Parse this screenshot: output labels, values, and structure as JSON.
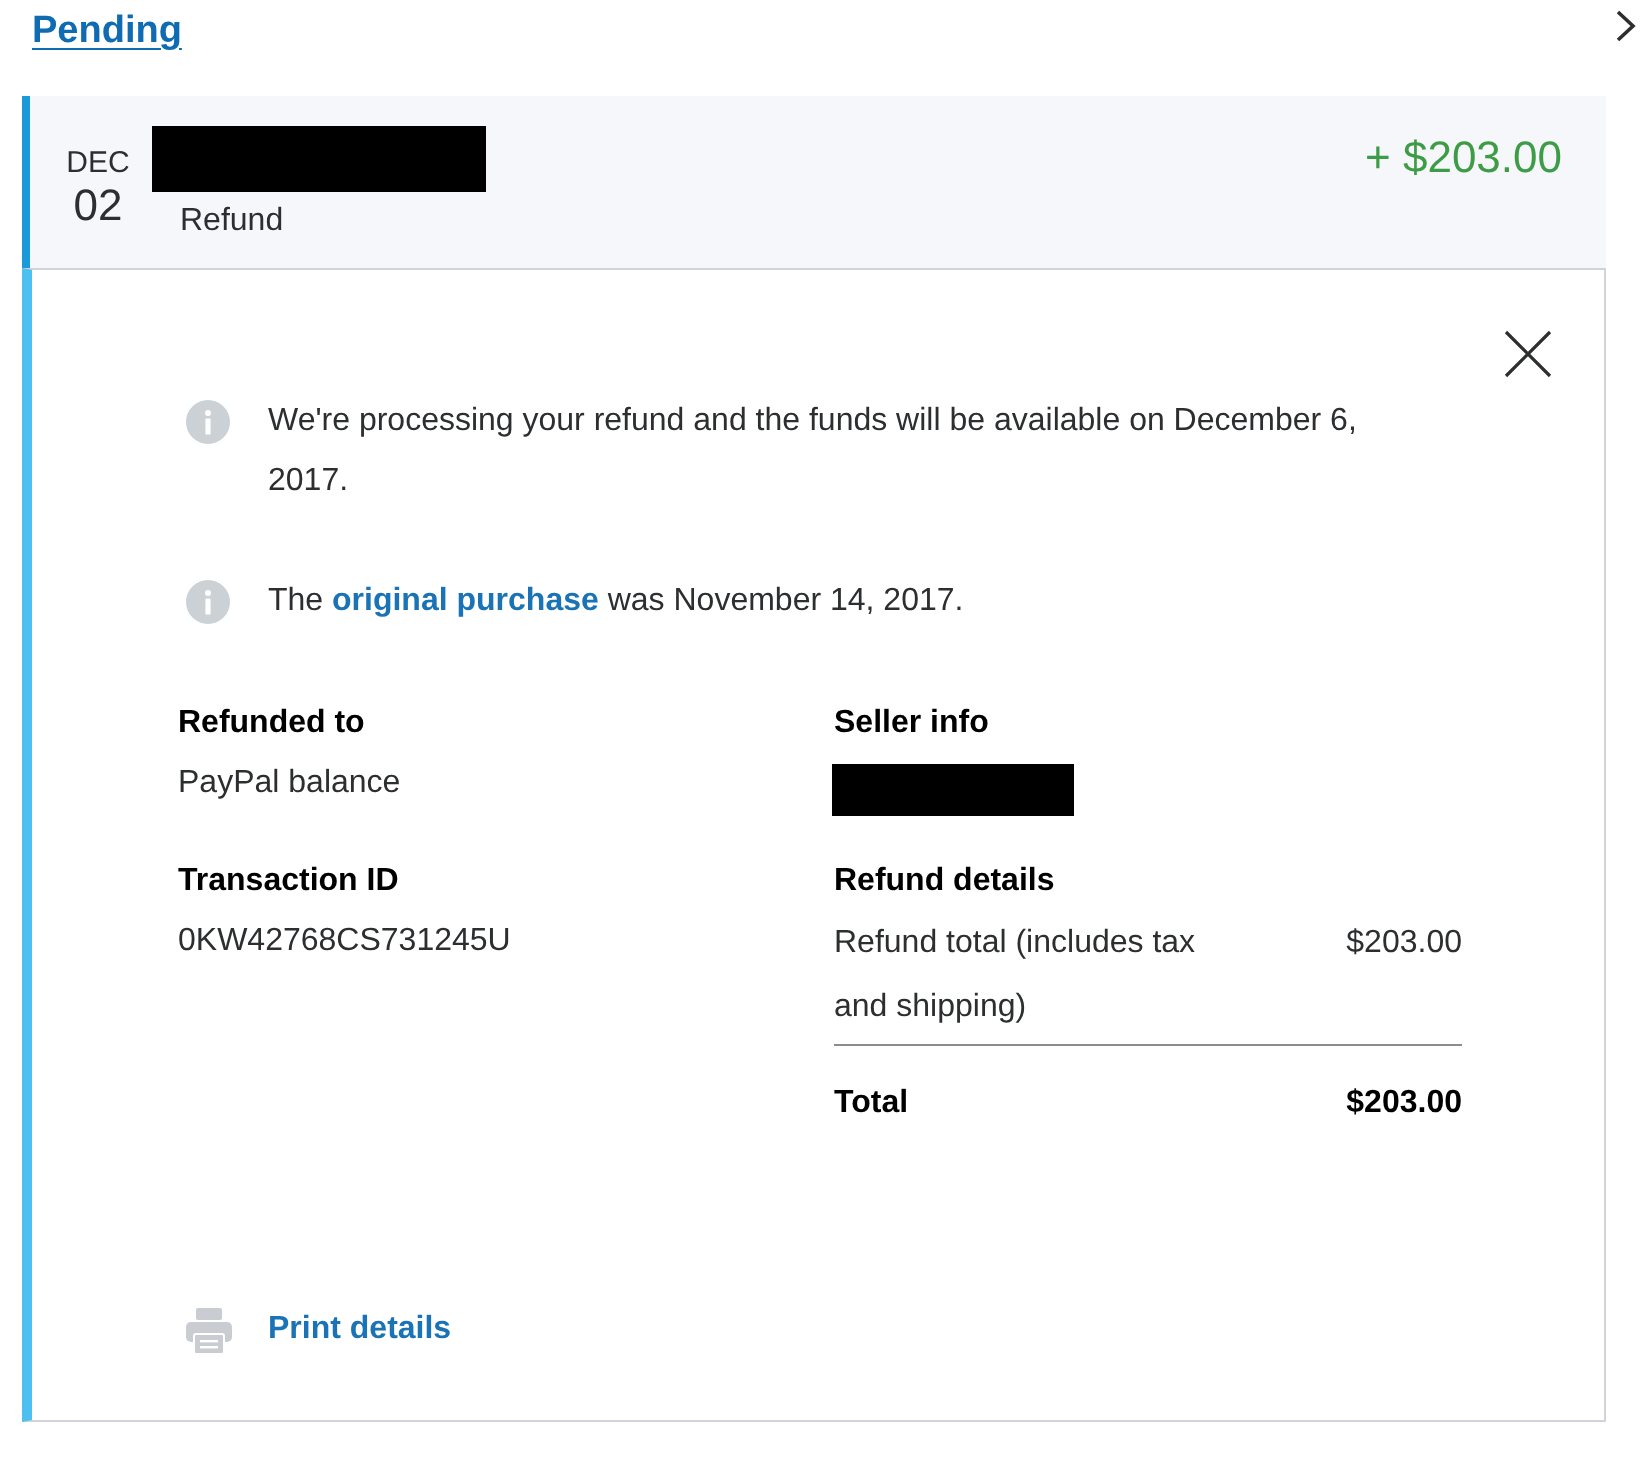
{
  "pending_link": "Pending",
  "transaction": {
    "month": "DEC",
    "day": "02",
    "name_redacted": true,
    "type": "Refund",
    "amount": "+ $203.00"
  },
  "notices": [
    {
      "parts": [
        {
          "text": "We're processing your refund and the funds will be available on December 6, 2017."
        }
      ]
    },
    {
      "parts": [
        {
          "text": "The "
        },
        {
          "text": "original purchase",
          "kind": "link"
        },
        {
          "text": " was November 14, 2017."
        }
      ]
    }
  ],
  "details_left": [
    {
      "label": "Refunded to",
      "value": "PayPal balance"
    },
    {
      "label": "Transaction ID",
      "value": "0KW42768CS731245U"
    }
  ],
  "seller_info": {
    "label": "Seller info",
    "redacted": true
  },
  "refund_details": {
    "label": "Refund details",
    "lines": [
      {
        "label": "Refund total (includes tax and shipping)",
        "amount": "$203.00"
      }
    ],
    "total": {
      "label": "Total",
      "amount": "$203.00"
    }
  },
  "print_link": "Print details"
}
